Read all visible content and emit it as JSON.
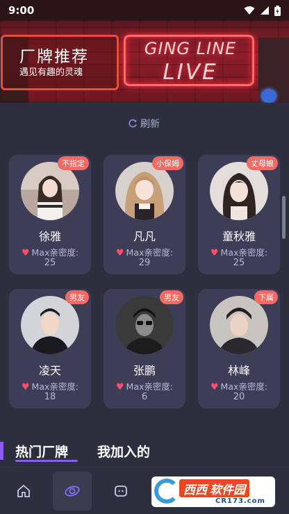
{
  "status_bar": {
    "time": "9:00",
    "icons": [
      "wifi-icon",
      "signal-icon",
      "battery-icon"
    ]
  },
  "banner": {
    "title": "厂牌推荐",
    "subtitle": "遇见有趣的灵魂",
    "neon_line1": "GING LINE",
    "neon_line2": "LIVE"
  },
  "refresh": {
    "label": "刷新",
    "icon": "refresh-icon"
  },
  "cards": [
    {
      "name": "徐雅",
      "tag": "不指定",
      "intimacy_label": "Max亲密度:",
      "intimacy_value": "25"
    },
    {
      "name": "凡凡",
      "tag": "小保姆",
      "intimacy_label": "Max亲密度:",
      "intimacy_value": "29"
    },
    {
      "name": "童秋雅",
      "tag": "丈母娘",
      "intimacy_label": "Max亲密度:",
      "intimacy_value": "25"
    },
    {
      "name": "凌天",
      "tag": "男友",
      "intimacy_label": "Max亲密度:",
      "intimacy_value": "18"
    },
    {
      "name": "张鹏",
      "tag": "男友",
      "intimacy_label": "Max亲密度:",
      "intimacy_value": "6"
    },
    {
      "name": "林峰",
      "tag": "下属",
      "intimacy_label": "Max亲密度:",
      "intimacy_value": "20"
    }
  ],
  "tabs": [
    {
      "label": "热门厂牌",
      "active": true
    },
    {
      "label": "我加入的",
      "active": false
    }
  ],
  "bottom_nav": {
    "items": [
      "home-icon",
      "discover-icon",
      "chat-icon"
    ],
    "active_index": 1
  },
  "watermark": {
    "main": "西西",
    "rest": "软件园",
    "sub": "CR173.com"
  },
  "colors": {
    "background": "#2c2f3d",
    "card": "#3d3d58",
    "tag": "#f26a63",
    "heart": "#ff4d6d",
    "accent": "#8c5cf0"
  }
}
